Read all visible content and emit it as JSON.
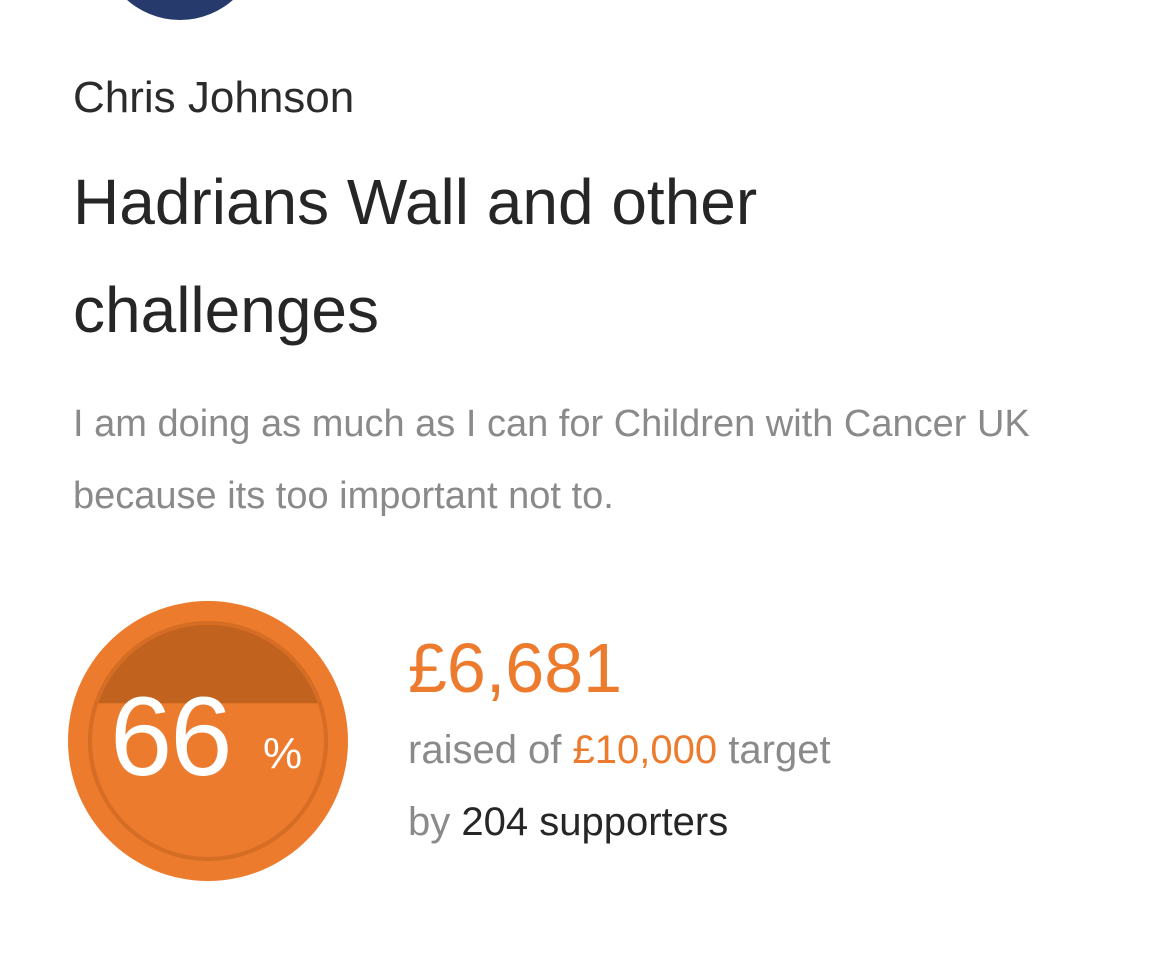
{
  "profile": {
    "owner_name": "Chris Johnson"
  },
  "page": {
    "title": "Hadrians Wall and other challenges",
    "description": "I am doing as much as I can for Children with Cancer UK because its too important not to."
  },
  "progress": {
    "percent_value": 66,
    "percent_label": "66",
    "percent_sign": "%",
    "raised_amount": "£6,681",
    "target_prefix": "raised of",
    "target_amount": "£10,000",
    "target_suffix": "target",
    "supporters_prefix": "by",
    "supporters_text": "204 supporters"
  },
  "colors": {
    "accent": "#ec7b2e",
    "accent_dark": "#c1631f",
    "muted_text": "#8a8a8a",
    "strong_text": "#262626"
  }
}
